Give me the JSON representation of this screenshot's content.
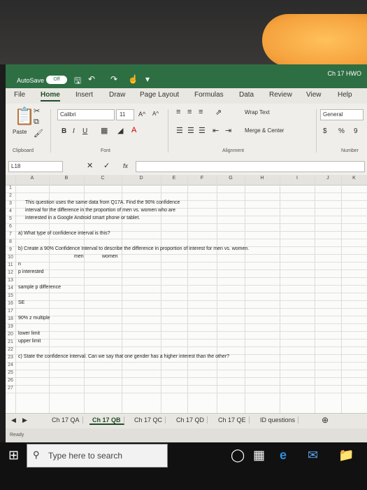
{
  "titlebar": {
    "autosave_label": "AutoSave",
    "autosave_state": "Off",
    "document_title": "Ch 17 HWO"
  },
  "tabs": [
    "File",
    "Home",
    "Insert",
    "Draw",
    "Page Layout",
    "Formulas",
    "Data",
    "Review",
    "View",
    "Help"
  ],
  "ribbon": {
    "paste_label": "Paste",
    "font_name": "Calibri",
    "font_size": "11",
    "grow_font": "A^",
    "shrink_font": "A^",
    "bold": "B",
    "italic": "I",
    "underline": "U",
    "wrap_text": "Wrap Text",
    "merge_center": "Merge & Center",
    "number_format": "General",
    "currency": "$",
    "percent": "%",
    "comma": "9",
    "groups": {
      "clipboard": "Clipboard",
      "font": "Font",
      "alignment": "Alignment",
      "number": "Number"
    }
  },
  "formula_bar": {
    "name_box": "L18",
    "fx": "fx",
    "content": ""
  },
  "columns": [
    "A",
    "B",
    "C",
    "D",
    "E",
    "F",
    "G",
    "H",
    "I",
    "J",
    "K"
  ],
  "rows": [
    "1",
    "2",
    "3",
    "4",
    "5",
    "6",
    "7",
    "8",
    "9",
    "10",
    "11",
    "12",
    "13",
    "14",
    "15",
    "16",
    "17",
    "18",
    "19",
    "20",
    "21",
    "22",
    "23",
    "24",
    "25",
    "26",
    "27"
  ],
  "cells": {
    "question_text_1": "This question uses the same data from Q17A.  Find the 90% confidence",
    "question_text_2": "interval for the difference in the proportion of men vs. women who are",
    "question_text_3": "interested in a Google Android smart phone or tablet.",
    "part_a": "a) What type of confidence interval is this?",
    "part_b": "b) Create a 90% Confidence Interval to describe the difference in proportion of interest for men vs. women.",
    "men": "men",
    "women": "women",
    "n": "n",
    "p_interested": "p interested",
    "sample_p_difference": "sample p difference",
    "se": "SE",
    "z_multiple": "90% z multiple",
    "lower_limit": "lower limit",
    "upper_limit": "upper limit",
    "part_c": "c) State the confidence interval.  Can we say that one gender has a higher interest than the other?"
  },
  "sheet_tabs": [
    "Ch 17 QA",
    "Ch 17 QB",
    "Ch 17 QC",
    "Ch 17 QD",
    "Ch 17 QE",
    "ID questions"
  ],
  "active_sheet": "Ch 17 QB",
  "status": "Ready",
  "taskbar": {
    "search_placeholder": "Type here to search"
  }
}
